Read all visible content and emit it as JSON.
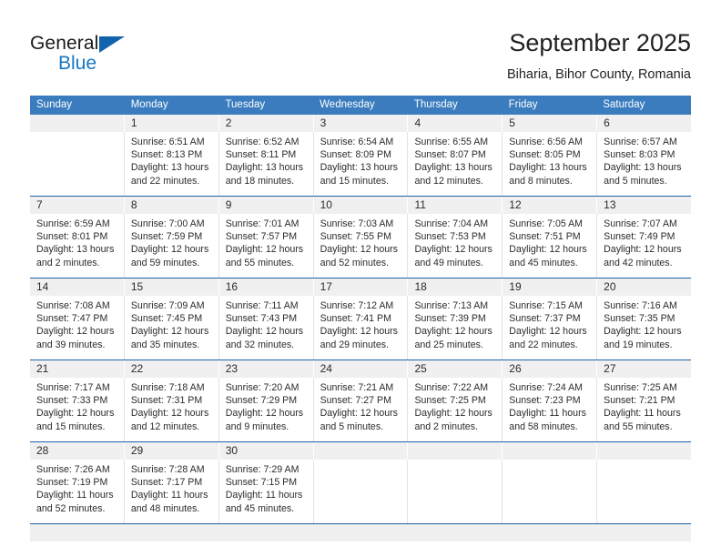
{
  "brand": {
    "word_top": "General",
    "word_bottom": "Blue",
    "triangle_color": "#1263ad",
    "blue_text_color": "#1577c4"
  },
  "header": {
    "title": "September 2025",
    "subtitle": "Biharia, Bihor County, Romania"
  },
  "theme": {
    "header_row_bg": "#3a7cbe",
    "week_rule": "#1d62a4",
    "number_row_bg": "#f0f0f0",
    "text": "#2b2b2b"
  },
  "weekdays": [
    "Sunday",
    "Monday",
    "Tuesday",
    "Wednesday",
    "Thursday",
    "Friday",
    "Saturday"
  ],
  "weeks": [
    {
      "days": [
        {
          "number": "",
          "lines": []
        },
        {
          "number": "1",
          "lines": [
            "Sunrise: 6:51 AM",
            "Sunset: 8:13 PM",
            "Daylight: 13 hours",
            "and 22 minutes."
          ]
        },
        {
          "number": "2",
          "lines": [
            "Sunrise: 6:52 AM",
            "Sunset: 8:11 PM",
            "Daylight: 13 hours",
            "and 18 minutes."
          ]
        },
        {
          "number": "3",
          "lines": [
            "Sunrise: 6:54 AM",
            "Sunset: 8:09 PM",
            "Daylight: 13 hours",
            "and 15 minutes."
          ]
        },
        {
          "number": "4",
          "lines": [
            "Sunrise: 6:55 AM",
            "Sunset: 8:07 PM",
            "Daylight: 13 hours",
            "and 12 minutes."
          ]
        },
        {
          "number": "5",
          "lines": [
            "Sunrise: 6:56 AM",
            "Sunset: 8:05 PM",
            "Daylight: 13 hours",
            "and 8 minutes."
          ]
        },
        {
          "number": "6",
          "lines": [
            "Sunrise: 6:57 AM",
            "Sunset: 8:03 PM",
            "Daylight: 13 hours",
            "and 5 minutes."
          ]
        }
      ]
    },
    {
      "days": [
        {
          "number": "7",
          "lines": [
            "Sunrise: 6:59 AM",
            "Sunset: 8:01 PM",
            "Daylight: 13 hours",
            "and 2 minutes."
          ]
        },
        {
          "number": "8",
          "lines": [
            "Sunrise: 7:00 AM",
            "Sunset: 7:59 PM",
            "Daylight: 12 hours",
            "and 59 minutes."
          ]
        },
        {
          "number": "9",
          "lines": [
            "Sunrise: 7:01 AM",
            "Sunset: 7:57 PM",
            "Daylight: 12 hours",
            "and 55 minutes."
          ]
        },
        {
          "number": "10",
          "lines": [
            "Sunrise: 7:03 AM",
            "Sunset: 7:55 PM",
            "Daylight: 12 hours",
            "and 52 minutes."
          ]
        },
        {
          "number": "11",
          "lines": [
            "Sunrise: 7:04 AM",
            "Sunset: 7:53 PM",
            "Daylight: 12 hours",
            "and 49 minutes."
          ]
        },
        {
          "number": "12",
          "lines": [
            "Sunrise: 7:05 AM",
            "Sunset: 7:51 PM",
            "Daylight: 12 hours",
            "and 45 minutes."
          ]
        },
        {
          "number": "13",
          "lines": [
            "Sunrise: 7:07 AM",
            "Sunset: 7:49 PM",
            "Daylight: 12 hours",
            "and 42 minutes."
          ]
        }
      ]
    },
    {
      "days": [
        {
          "number": "14",
          "lines": [
            "Sunrise: 7:08 AM",
            "Sunset: 7:47 PM",
            "Daylight: 12 hours",
            "and 39 minutes."
          ]
        },
        {
          "number": "15",
          "lines": [
            "Sunrise: 7:09 AM",
            "Sunset: 7:45 PM",
            "Daylight: 12 hours",
            "and 35 minutes."
          ]
        },
        {
          "number": "16",
          "lines": [
            "Sunrise: 7:11 AM",
            "Sunset: 7:43 PM",
            "Daylight: 12 hours",
            "and 32 minutes."
          ]
        },
        {
          "number": "17",
          "lines": [
            "Sunrise: 7:12 AM",
            "Sunset: 7:41 PM",
            "Daylight: 12 hours",
            "and 29 minutes."
          ]
        },
        {
          "number": "18",
          "lines": [
            "Sunrise: 7:13 AM",
            "Sunset: 7:39 PM",
            "Daylight: 12 hours",
            "and 25 minutes."
          ]
        },
        {
          "number": "19",
          "lines": [
            "Sunrise: 7:15 AM",
            "Sunset: 7:37 PM",
            "Daylight: 12 hours",
            "and 22 minutes."
          ]
        },
        {
          "number": "20",
          "lines": [
            "Sunrise: 7:16 AM",
            "Sunset: 7:35 PM",
            "Daylight: 12 hours",
            "and 19 minutes."
          ]
        }
      ]
    },
    {
      "days": [
        {
          "number": "21",
          "lines": [
            "Sunrise: 7:17 AM",
            "Sunset: 7:33 PM",
            "Daylight: 12 hours",
            "and 15 minutes."
          ]
        },
        {
          "number": "22",
          "lines": [
            "Sunrise: 7:18 AM",
            "Sunset: 7:31 PM",
            "Daylight: 12 hours",
            "and 12 minutes."
          ]
        },
        {
          "number": "23",
          "lines": [
            "Sunrise: 7:20 AM",
            "Sunset: 7:29 PM",
            "Daylight: 12 hours",
            "and 9 minutes."
          ]
        },
        {
          "number": "24",
          "lines": [
            "Sunrise: 7:21 AM",
            "Sunset: 7:27 PM",
            "Daylight: 12 hours",
            "and 5 minutes."
          ]
        },
        {
          "number": "25",
          "lines": [
            "Sunrise: 7:22 AM",
            "Sunset: 7:25 PM",
            "Daylight: 12 hours",
            "and 2 minutes."
          ]
        },
        {
          "number": "26",
          "lines": [
            "Sunrise: 7:24 AM",
            "Sunset: 7:23 PM",
            "Daylight: 11 hours",
            "and 58 minutes."
          ]
        },
        {
          "number": "27",
          "lines": [
            "Sunrise: 7:25 AM",
            "Sunset: 7:21 PM",
            "Daylight: 11 hours",
            "and 55 minutes."
          ]
        }
      ]
    },
    {
      "days": [
        {
          "number": "28",
          "lines": [
            "Sunrise: 7:26 AM",
            "Sunset: 7:19 PM",
            "Daylight: 11 hours",
            "and 52 minutes."
          ]
        },
        {
          "number": "29",
          "lines": [
            "Sunrise: 7:28 AM",
            "Sunset: 7:17 PM",
            "Daylight: 11 hours",
            "and 48 minutes."
          ]
        },
        {
          "number": "30",
          "lines": [
            "Sunrise: 7:29 AM",
            "Sunset: 7:15 PM",
            "Daylight: 11 hours",
            "and 45 minutes."
          ]
        },
        {
          "number": "",
          "lines": []
        },
        {
          "number": "",
          "lines": []
        },
        {
          "number": "",
          "lines": []
        },
        {
          "number": "",
          "lines": []
        }
      ]
    }
  ]
}
